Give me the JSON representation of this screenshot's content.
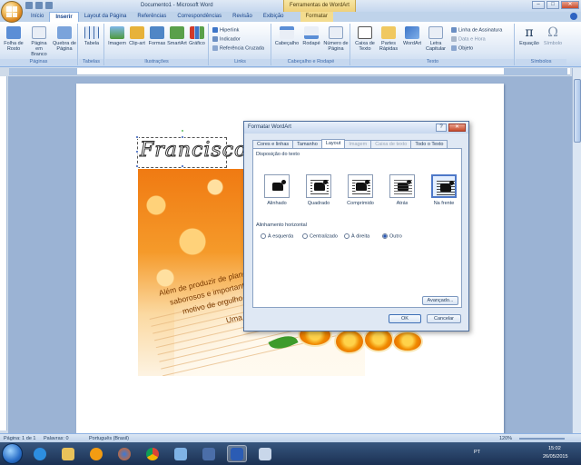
{
  "window": {
    "title": "Documento1 - Microsoft Word",
    "context_title": "Ferramentas de WordArt",
    "minimize": "–",
    "maximize": "□",
    "close": "✕"
  },
  "tabs": [
    {
      "label": "Início"
    },
    {
      "label": "Inserir"
    },
    {
      "label": "Layout da Página"
    },
    {
      "label": "Referências"
    },
    {
      "label": "Correspondências"
    },
    {
      "label": "Revisão"
    },
    {
      "label": "Exibição"
    },
    {
      "label": "Formatar"
    }
  ],
  "ribbon": {
    "paginas": {
      "label": "Páginas",
      "b1": "Folha de Rosto",
      "b2": "Página em Branco",
      "b3": "Quebra de Página"
    },
    "tabelas": {
      "label": "Tabelas",
      "b1": "Tabela"
    },
    "ilustracoes": {
      "label": "Ilustrações",
      "b1": "Imagem",
      "b2": "Clip-art",
      "b3": "Formas",
      "b4": "SmartArt",
      "b5": "Gráfico"
    },
    "links": {
      "label": "Links",
      "b1": "Hiperlink",
      "b2": "Indicador",
      "b3": "Referência Cruzada"
    },
    "cabecalho": {
      "label": "Cabeçalho e Rodapé",
      "b1": "Cabeçalho",
      "b2": "Rodapé",
      "b3": "Número de Página"
    },
    "texto": {
      "label": "Texto",
      "b1": "Caixa de Texto",
      "b2": "Partes Rápidas",
      "b3": "WordArt",
      "b4": "Letra Capitular",
      "s1": "Linha de Assinatura",
      "s2": "Data e Hora",
      "s3": "Objeto"
    },
    "simbolos": {
      "label": "Símbolos",
      "b1": "Equação",
      "b2": "Símbolo"
    }
  },
  "wordart": {
    "text": "Francisco"
  },
  "poster": {
    "line1": "Além de produzir de plancar",
    "line2": "saborosos e importantes",
    "line3": "motivo de orgulho p",
    "line4": "Uma no"
  },
  "dialog": {
    "title": "Formatar WordArt",
    "help": "?",
    "close": "✕",
    "tabs": [
      {
        "label": "Cores e linhas"
      },
      {
        "label": "Tamanho"
      },
      {
        "label": "Layout"
      },
      {
        "label": "Imagem"
      },
      {
        "label": "Caixa de texto"
      },
      {
        "label": "Todo o Texto"
      }
    ],
    "wrap_section": "Disposição do texto",
    "wrap_options": [
      {
        "label": "Alinhado"
      },
      {
        "label": "Quadrado"
      },
      {
        "label": "Comprimido"
      },
      {
        "label": "Atrás"
      },
      {
        "label": "Na frente"
      }
    ],
    "align_section": "Alinhamento horizontal",
    "align_options": [
      {
        "label": "À esquerda"
      },
      {
        "label": "Centralizado"
      },
      {
        "label": "À direita"
      },
      {
        "label": "Outro"
      }
    ],
    "advanced": "Avançado...",
    "ok": "OK",
    "cancel": "Cancelar"
  },
  "status": {
    "page": "Página: 1 de 1",
    "words": "Palavras: 0",
    "language": "Português (Brasil)",
    "zoom": "120%"
  },
  "tray": {
    "lang": "PT",
    "time": "15:02",
    "date": "26/05/2015"
  }
}
